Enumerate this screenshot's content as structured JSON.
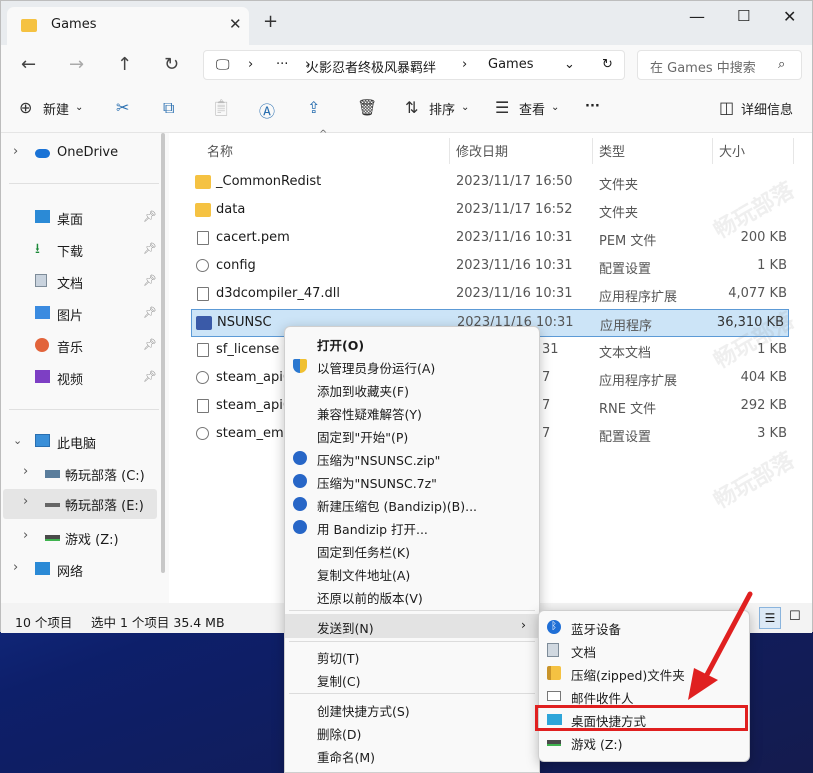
{
  "window": {
    "tab_title": "Games",
    "new_tab_symbol": "+",
    "close_symbol": "✕"
  },
  "address": {
    "ellipsis": "···",
    "path": [
      "火影忍者终极风暴羁绊",
      "Games"
    ],
    "search_placeholder": "在 Games 中搜索"
  },
  "toolbar": {
    "new_label": "新建",
    "sort_label": "排序",
    "view_label": "查看",
    "more_label": "···",
    "details_label": "详细信息"
  },
  "sidebar": {
    "onedrive": "OneDrive",
    "quick": [
      "桌面",
      "下载",
      "文档",
      "图片",
      "音乐",
      "视频"
    ],
    "this_pc": "此电脑",
    "drives": [
      "畅玩部落 (C:)",
      "畅玩部落 (E:)",
      "游戏 (Z:)"
    ],
    "network": "网络"
  },
  "columns": {
    "name": "名称",
    "modified": "修改日期",
    "type": "类型",
    "size": "大小"
  },
  "files": [
    {
      "name": "_CommonRedist",
      "modified": "2023/11/17 16:50",
      "type": "文件夹",
      "size": "",
      "icon": "folder"
    },
    {
      "name": "data",
      "modified": "2023/11/17 16:52",
      "type": "文件夹",
      "size": "",
      "icon": "folder"
    },
    {
      "name": "cacert.pem",
      "modified": "2023/11/16 10:31",
      "type": "PEM 文件",
      "size": "200 KB",
      "icon": "doc"
    },
    {
      "name": "config",
      "modified": "2023/11/16 10:31",
      "type": "配置设置",
      "size": "1 KB",
      "icon": "gear"
    },
    {
      "name": "d3dcompiler_47.dll",
      "modified": "2023/11/16 10:31",
      "type": "应用程序扩展",
      "size": "4,077 KB",
      "icon": "doc"
    },
    {
      "name": "NSUNSC",
      "modified": "2023/11/16 10:31",
      "type": "应用程序",
      "size": "36,310 KB",
      "icon": "app"
    },
    {
      "name": "sf_license",
      "modified": "31",
      "type": "文本文档",
      "size": "1 KB",
      "icon": "doc"
    },
    {
      "name": "steam_api6",
      "modified": "7",
      "type": "应用程序扩展",
      "size": "404 KB",
      "icon": "gear"
    },
    {
      "name": "steam_api6",
      "modified": "7",
      "type": "RNE 文件",
      "size": "292 KB",
      "icon": "doc"
    },
    {
      "name": "steam_emu",
      "modified": "7",
      "type": "配置设置",
      "size": "3 KB",
      "icon": "gear"
    }
  ],
  "status": {
    "count": "10 个项目",
    "selected": "选中 1 个项目  35.4 MB"
  },
  "context_menu": {
    "items": [
      "打开(O)",
      "以管理员身份运行(A)",
      "添加到收藏夹(F)",
      "兼容性疑难解答(Y)",
      "固定到\"开始\"(P)",
      "压缩为\"NSUNSC.zip\"",
      "压缩为\"NSUNSC.7z\"",
      "新建压缩包 (Bandizip)(B)...",
      "用 Bandizip 打开...",
      "固定到任务栏(K)",
      "复制文件地址(A)",
      "还原以前的版本(V)"
    ],
    "send_to": "发送到(N)",
    "send_to_arrow": "›",
    "group2": [
      "剪切(T)",
      "复制(C)"
    ],
    "group3": [
      "创建快捷方式(S)",
      "删除(D)",
      "重命名(M)"
    ]
  },
  "send_to_menu": {
    "items": [
      "蓝牙设备",
      "文档",
      "压缩(zipped)文件夹",
      "邮件收件人",
      "桌面快捷方式",
      "游戏 (Z:)"
    ]
  },
  "colors": {
    "accent": "#0067c0",
    "highlight_red": "#e02020",
    "selection": "#cce4f7"
  }
}
